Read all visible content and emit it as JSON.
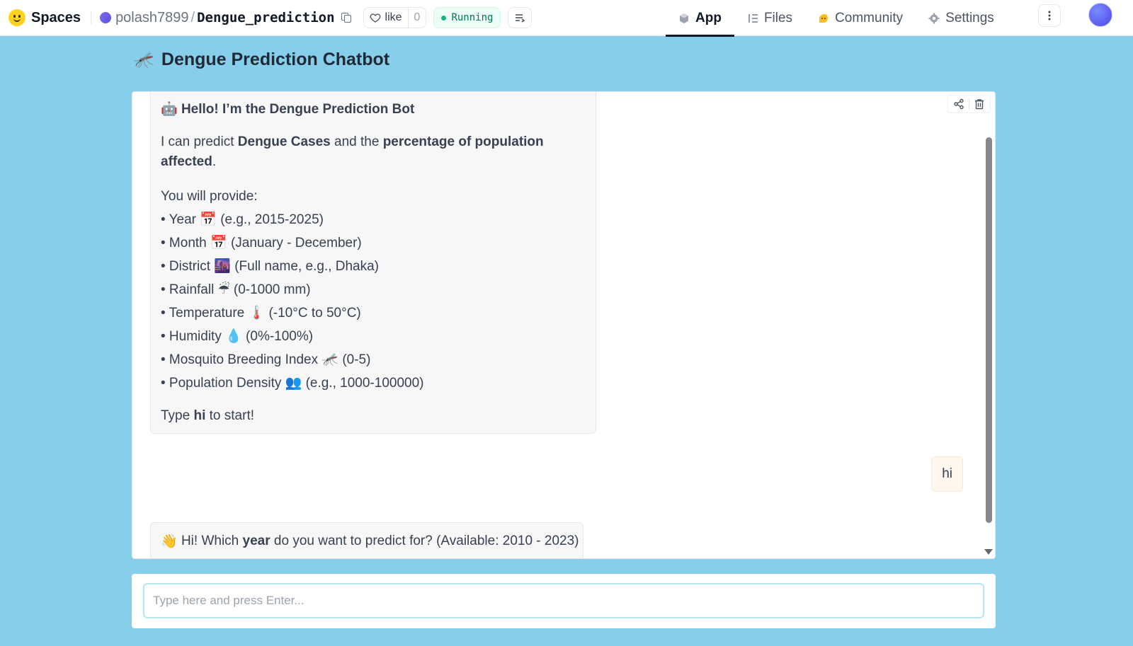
{
  "nav": {
    "brand": "Spaces",
    "owner": "polash7899",
    "separator": "/",
    "repo": "Dengue_prediction",
    "like_label": "like",
    "like_count": "0",
    "status": "Running",
    "tabs": [
      {
        "label": "App",
        "icon": "cube-icon",
        "active": true
      },
      {
        "label": "Files",
        "icon": "files-icon",
        "active": false
      },
      {
        "label": "Community",
        "icon": "community-icon",
        "active": false
      },
      {
        "label": "Settings",
        "icon": "gear-icon",
        "active": false
      }
    ]
  },
  "app": {
    "title_emoji": "🦟",
    "title": "Dengue Prediction Chatbot"
  },
  "chat": {
    "intro": {
      "head_emoji": "🤖",
      "head": "Hello! I’m the Dengue Prediction Bot",
      "line1_a": "I can predict ",
      "line1_b": "Dengue Cases",
      "line1_c": " and the ",
      "line1_d": "percentage of population affected",
      "line1_e": ".",
      "provide": "You will provide:",
      "items": [
        "• Year 📅 (e.g., 2015-2025)",
        "• Month 📅 (January - December)",
        "• District 🌆 (Full name, e.g., Dhaka)",
        "• Rainfall ☔ (0-1000 mm)",
        "• Temperature 🌡️ (-10°C to 50°C)",
        "• Humidity 💧 (0%-100%)",
        "• Mosquito Breeding Index 🦟 (0-5)",
        "• Population Density 👥 (e.g., 1000-100000)"
      ],
      "start_a": "Type ",
      "start_b": "hi",
      "start_c": " to start!"
    },
    "user_message": "hi",
    "reply": {
      "emoji": "👋",
      "a": " Hi! Which ",
      "b": "year",
      "c": " do you want to predict for? (Available: 2010 - 2023)"
    }
  },
  "input": {
    "placeholder": "Type here and press Enter..."
  },
  "colors": {
    "background": "#87ceeb",
    "status": "#10b981",
    "input_border": "#b3e5f7"
  }
}
